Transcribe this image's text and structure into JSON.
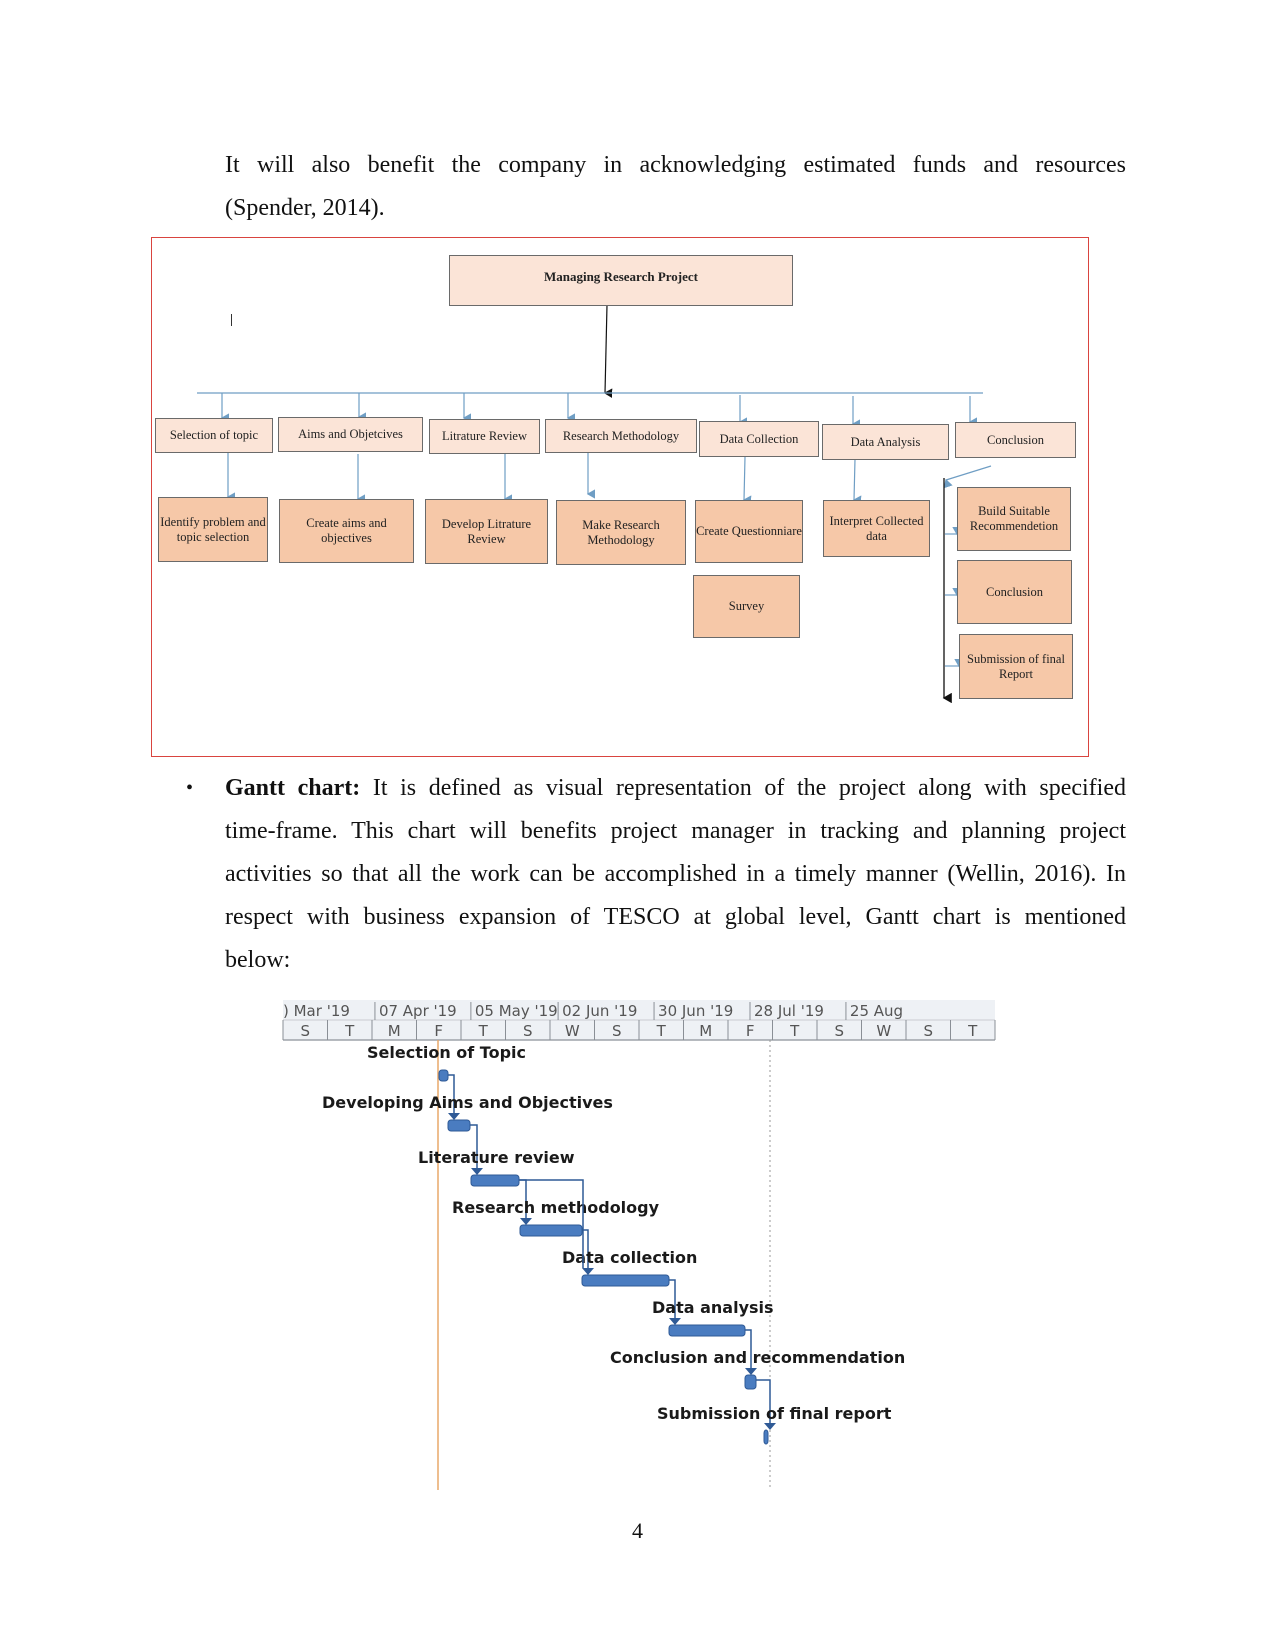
{
  "intro": {
    "line1": "It will also benefit the company in acknowledging estimated funds and resources",
    "line2": "(Spender, 2014)."
  },
  "orgchart": {
    "root": "Managing Research Project",
    "cursor_glyph": "|",
    "level1": [
      "Selection of topic",
      "Aims and Objetcives",
      "Litrature Review",
      "Research Methodology",
      "Data Collection",
      "Data Analysis",
      "Conclusion"
    ],
    "level2": [
      "Identify problem and topic selection",
      "Create aims and objectives",
      "Develop Litrature Review",
      "Make Research Methodology",
      "Create Questionniare",
      "Interpret Collected data",
      "Build Suitable Recommendetion"
    ],
    "survey": "Survey",
    "conclusion_children": [
      "Conclusion",
      "Submission of final Report"
    ],
    "colors": {
      "frame": "#d9443f",
      "level1_fill": "#fbe4d7",
      "level2_fill": "#f6c8a8",
      "connector": "#6f9ec4"
    }
  },
  "gantt_section": {
    "bullet": "•",
    "heading": "Gantt chart:",
    "line1_rest": " It is defined as visual representation of the project along with specified",
    "line2": "time-frame. This chart will benefits project manager in tracking and planning project",
    "line3": "activities so that all the work can be accomplished in a timely manner (Wellin, 2016).  In",
    "line4": "respect with business expansion of TESCO at global level, Gantt chart is mentioned",
    "line5": "below:"
  },
  "chart_data": {
    "type": "gantt",
    "title": "",
    "timescale_top": [
      ") Mar '19",
      "07 Apr '19",
      "05 May '19",
      "02 Jun '19",
      "30 Jun '19",
      "28 Jul '19",
      "25 Aug"
    ],
    "timescale_bottom": [
      "S",
      "T",
      "M",
      "F",
      "T",
      "S",
      "W",
      "S",
      "T",
      "M",
      "F",
      "T",
      "S",
      "W",
      "S",
      "T"
    ],
    "tasks": [
      {
        "name": "Selection of Topic",
        "start_unit": 3.7,
        "end_unit": 3.85
      },
      {
        "name": "Developing Aims and Objectives",
        "start_unit": 3.85,
        "end_unit": 4.1
      },
      {
        "name": "Literature review",
        "start_unit": 4.3,
        "end_unit": 4.85
      },
      {
        "name": "Research methodology",
        "start_unit": 5.2,
        "end_unit": 5.9
      },
      {
        "name": "Data collection",
        "start_unit": 5.9,
        "end_unit": 6.9
      },
      {
        "name": "Data analysis",
        "start_unit": 6.9,
        "end_unit": 7.75
      },
      {
        "name": "Conclusion and recommendation",
        "start_unit": 7.8,
        "end_unit": 7.9
      },
      {
        "name": "Submission of final report",
        "start_unit": 7.95,
        "end_unit": 8.0
      }
    ],
    "markers": [
      {
        "kind": "today",
        "unit": 3.6,
        "color": "#e8a86a"
      },
      {
        "kind": "deadline",
        "unit": 8.05,
        "color": "#999999"
      }
    ],
    "bar_color": "#4a7cc0"
  },
  "footer": {
    "page_number": "4"
  }
}
